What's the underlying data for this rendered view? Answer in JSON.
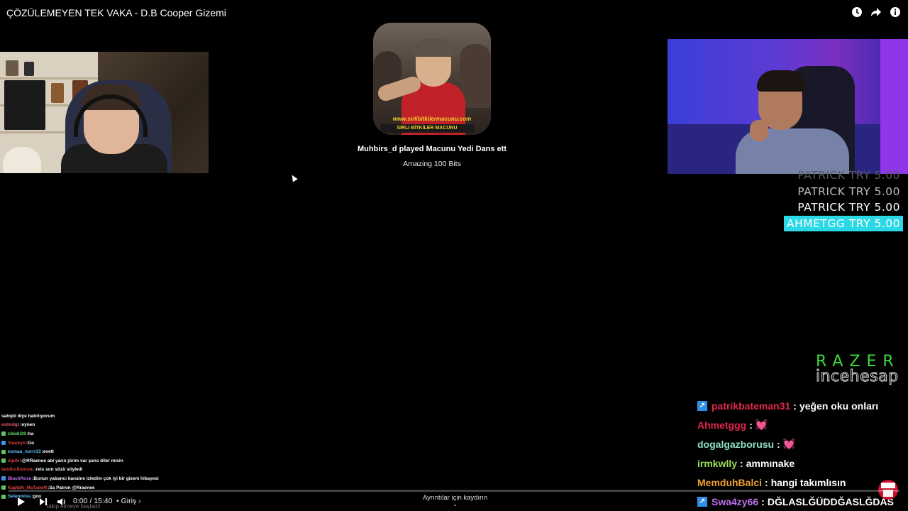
{
  "video": {
    "title": "ÇÖZÜLEMEYEN TEK VAKA - D.B Cooper Gizemi",
    "icons": [
      "watch-later-icon",
      "share-icon",
      "info-icon"
    ]
  },
  "alert": {
    "image_caption_url": "www.sirlibitkilermacunu.com",
    "image_caption_brand": "SIRLI BİTKİLER MACUNU",
    "message": "Muhbirs_d played Macunu Yedi Dans ett",
    "sub": "Amazing 100 Bits"
  },
  "ticker": [
    {
      "text": "PATRICK  TRY 5.00",
      "state": "fade1"
    },
    {
      "text": "PATRICK  TRY 5.00",
      "state": "fade2"
    },
    {
      "text": "PATRICK  TRY 5.00",
      "state": "full"
    },
    {
      "text": "AHMETGG  TRY 5.00",
      "state": "active"
    }
  ],
  "razer": {
    "brand": "RAZER",
    "handle": "incehesap"
  },
  "chat_right": [
    {
      "badge": true,
      "user": "patrikbateman31",
      "color": "#e0284a",
      "msg": "yeğen oku onları"
    },
    {
      "badge": false,
      "user": "Ahmetggg",
      "color": "#e0284a",
      "msg": "💓"
    },
    {
      "badge": false,
      "user": "dogalgazborusu",
      "color": "#8fe0c0",
      "msg": "💓"
    },
    {
      "badge": false,
      "user": "irmkwlly",
      "color": "#9ae05a",
      "msg": "ammınake"
    },
    {
      "badge": false,
      "user": "MemduhBalci",
      "color": "#f0a030",
      "msg": "hangi takımlısın"
    },
    {
      "badge": true,
      "user": "Swa4zy66",
      "color": "#c070f0",
      "msg": "DĞLASLĞÜDDĞASLĞDAS"
    }
  ],
  "chat_left": [
    {
      "user": "",
      "color": "#fff",
      "msg": "sahipti diye hatırlıyorum",
      "badge": ""
    },
    {
      "user": "eslmdgr",
      "color": "#e05060",
      "msg": "eynen",
      "badge": ""
    },
    {
      "user": "zibidii28",
      "color": "#60e060",
      "msg": "ha",
      "badge": "#60c060"
    },
    {
      "user": "Yaareyn",
      "color": "#e04040",
      "msg": "Go",
      "badge": "#4090f0"
    },
    {
      "user": "esmaa_nurrr33",
      "color": "#60c0ff",
      "msg": "evett",
      "badge": "#60c060"
    },
    {
      "user": "sipile",
      "color": "#e04040",
      "msg": "@RRaenee abi yarın jürim var şans diler misin",
      "badge": "#60c060"
    },
    {
      "user": "tandirciborusu",
      "color": "#e04040",
      "msg": "reis son sözü söyledi",
      "badge": ""
    },
    {
      "user": "BlackRose",
      "color": "#c070f0",
      "msg": "Bunun yabancı kanalını izledim çok iyi bir gizem hikayesi",
      "badge": "#4090f0"
    },
    {
      "user": "KaptaN_MaTadoR",
      "color": "#e04040",
      "msg": "Sa Patron @Rraenee",
      "badge": "#60c060"
    },
    {
      "user": "Selenmiss",
      "color": "#60c0ff",
      "msg": "goo",
      "badge": "#60c060"
    }
  ],
  "follow_text": "takip etmeye başladı!",
  "player": {
    "time": "0:00 / 15:40",
    "chapter": "• Giriş ›",
    "scroll_hint": "Ayrıntılar için kaydırın",
    "progress": 0
  },
  "colors": {
    "ticker_active": "#2ad8e6",
    "razer_green": "#3ddc3d",
    "badge_blue": "#2f8fe8"
  }
}
